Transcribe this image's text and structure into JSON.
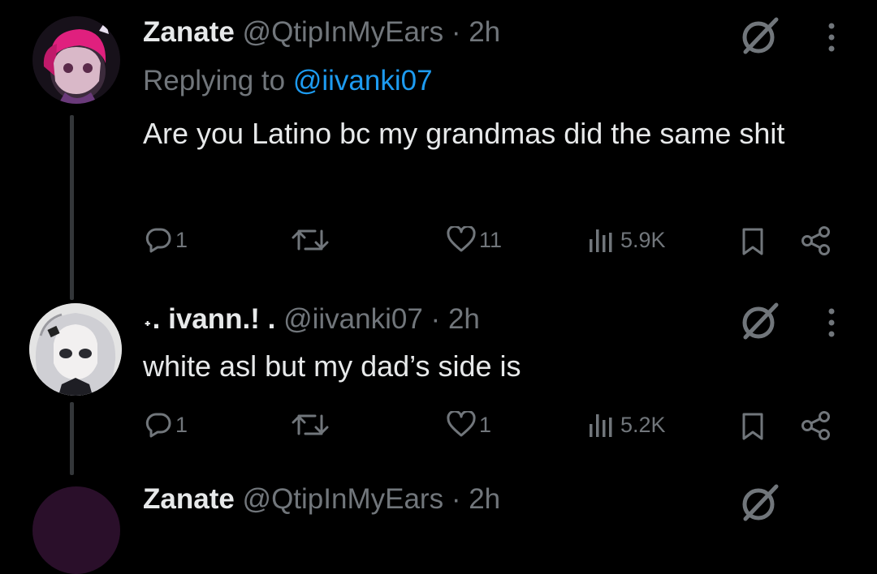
{
  "tweets": [
    {
      "display_name": "Zanate",
      "handle": "@QtipInMyEars",
      "separator": "·",
      "time": "2h",
      "replying_prefix": "Replying to",
      "replying_to": "@iivanki07",
      "text": "Are you Latino bc my grandmas did the same shit",
      "actions": {
        "replies": "1",
        "retweets": "",
        "likes": "11",
        "views": "5.9K"
      }
    },
    {
      "display_name": "˖. ivann.! .",
      "handle": "@iivanki07",
      "separator": "·",
      "time": "2h",
      "text": "white asl but my dad’s side is",
      "actions": {
        "replies": "1",
        "retweets": "",
        "likes": "1",
        "views": "5.2K"
      }
    }
  ],
  "next_tweet_partial": {
    "display_name": "Zanate",
    "handle": "@QtipInMyEars",
    "separator": "·",
    "time": "2h"
  },
  "colors": {
    "background": "#000000",
    "text": "#e7e9ea",
    "muted": "#71767b",
    "link": "#1d9bf0",
    "thread_line": "#333639"
  },
  "icons": [
    "grok-icon",
    "more-icon",
    "reply-icon",
    "retweet-icon",
    "like-icon",
    "views-icon",
    "bookmark-icon",
    "share-icon"
  ]
}
